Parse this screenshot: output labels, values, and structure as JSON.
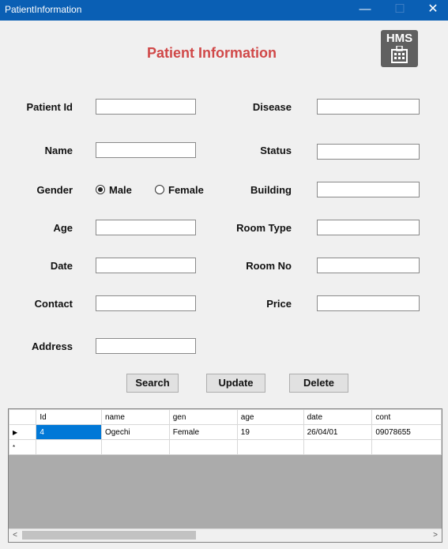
{
  "window": {
    "title": "PatientInformation",
    "min_glyph": "—",
    "max_glyph": "☐",
    "close_glyph": "✕"
  },
  "heading": "Patient Information",
  "logo": {
    "text": "HMS",
    "icon": "hospital-icon"
  },
  "labels": {
    "patient_id": "Patient Id",
    "name": "Name",
    "gender": "Gender",
    "age": "Age",
    "date": "Date",
    "contact": "Contact",
    "address": "Address",
    "disease": "Disease",
    "status": "Status",
    "building": "Building",
    "room_type": "Room Type",
    "room_no": "Room No",
    "price": "Price"
  },
  "fields": {
    "patient_id": "",
    "name": "",
    "age": "",
    "date": "",
    "contact": "",
    "address": "",
    "disease": "",
    "status": "",
    "building": "",
    "room_type": "",
    "room_no": "",
    "price": ""
  },
  "gender_options": {
    "male": "Male",
    "female": "Female",
    "selected": "Male"
  },
  "buttons": {
    "search": "Search",
    "update": "Update",
    "delete": "Delete"
  },
  "grid": {
    "columns": [
      "Id",
      "name",
      "gen",
      "age",
      "date",
      "cont"
    ],
    "rows": [
      {
        "marker": "▶",
        "cells": [
          "4",
          "Ogechi",
          "Female",
          "19",
          "26/04/01",
          "09078655"
        ]
      }
    ],
    "new_row_marker": "*"
  },
  "scroll": {
    "left": "<",
    "right": ">"
  }
}
